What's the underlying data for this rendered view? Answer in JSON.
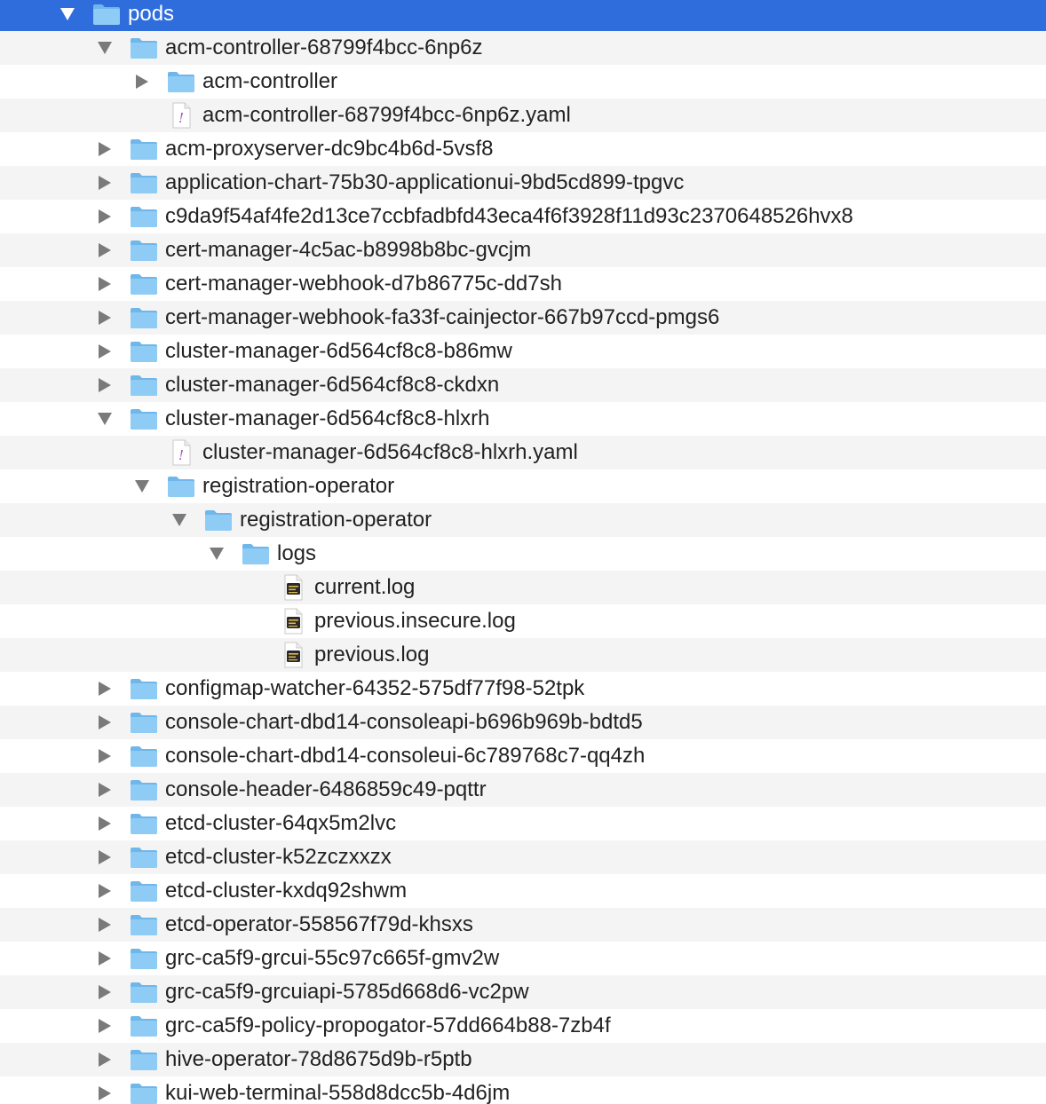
{
  "colors": {
    "selection": "#2f6ddc",
    "folder_icon": "#8ecbf5",
    "stripe": "#f4f4f5"
  },
  "tree": {
    "rows": [
      {
        "depth": 0,
        "type": "folder",
        "expanded": true,
        "selected": true,
        "label": "pods"
      },
      {
        "depth": 1,
        "type": "folder",
        "expanded": true,
        "label": "acm-controller-68799f4bcc-6np6z"
      },
      {
        "depth": 2,
        "type": "folder",
        "expanded": false,
        "label": "acm-controller"
      },
      {
        "depth": 2,
        "type": "yaml",
        "label": "acm-controller-68799f4bcc-6np6z.yaml"
      },
      {
        "depth": 1,
        "type": "folder",
        "expanded": false,
        "label": "acm-proxyserver-dc9bc4b6d-5vsf8"
      },
      {
        "depth": 1,
        "type": "folder",
        "expanded": false,
        "label": "application-chart-75b30-applicationui-9bd5cd899-tpgvc"
      },
      {
        "depth": 1,
        "type": "folder",
        "expanded": false,
        "label": "c9da9f54af4fe2d13ce7ccbfadbfd43eca4f6f3928f11d93c2370648526hvx8"
      },
      {
        "depth": 1,
        "type": "folder",
        "expanded": false,
        "label": "cert-manager-4c5ac-b8998b8bc-gvcjm"
      },
      {
        "depth": 1,
        "type": "folder",
        "expanded": false,
        "label": "cert-manager-webhook-d7b86775c-dd7sh"
      },
      {
        "depth": 1,
        "type": "folder",
        "expanded": false,
        "label": "cert-manager-webhook-fa33f-cainjector-667b97ccd-pmgs6"
      },
      {
        "depth": 1,
        "type": "folder",
        "expanded": false,
        "label": "cluster-manager-6d564cf8c8-b86mw"
      },
      {
        "depth": 1,
        "type": "folder",
        "expanded": false,
        "label": "cluster-manager-6d564cf8c8-ckdxn"
      },
      {
        "depth": 1,
        "type": "folder",
        "expanded": true,
        "label": "cluster-manager-6d564cf8c8-hlxrh"
      },
      {
        "depth": 2,
        "type": "yaml",
        "label": "cluster-manager-6d564cf8c8-hlxrh.yaml"
      },
      {
        "depth": 2,
        "type": "folder",
        "expanded": true,
        "label": "registration-operator"
      },
      {
        "depth": 3,
        "type": "folder",
        "expanded": true,
        "label": "registration-operator"
      },
      {
        "depth": 4,
        "type": "folder",
        "expanded": true,
        "label": "logs"
      },
      {
        "depth": 5,
        "type": "log",
        "label": "current.log"
      },
      {
        "depth": 5,
        "type": "log",
        "label": "previous.insecure.log"
      },
      {
        "depth": 5,
        "type": "log",
        "label": "previous.log"
      },
      {
        "depth": 1,
        "type": "folder",
        "expanded": false,
        "label": "configmap-watcher-64352-575df77f98-52tpk"
      },
      {
        "depth": 1,
        "type": "folder",
        "expanded": false,
        "label": "console-chart-dbd14-consoleapi-b696b969b-bdtd5"
      },
      {
        "depth": 1,
        "type": "folder",
        "expanded": false,
        "label": "console-chart-dbd14-consoleui-6c789768c7-qq4zh"
      },
      {
        "depth": 1,
        "type": "folder",
        "expanded": false,
        "label": "console-header-6486859c49-pqttr"
      },
      {
        "depth": 1,
        "type": "folder",
        "expanded": false,
        "label": "etcd-cluster-64qx5m2lvc"
      },
      {
        "depth": 1,
        "type": "folder",
        "expanded": false,
        "label": "etcd-cluster-k52zczxxzx"
      },
      {
        "depth": 1,
        "type": "folder",
        "expanded": false,
        "label": "etcd-cluster-kxdq92shwm"
      },
      {
        "depth": 1,
        "type": "folder",
        "expanded": false,
        "label": "etcd-operator-558567f79d-khsxs"
      },
      {
        "depth": 1,
        "type": "folder",
        "expanded": false,
        "label": "grc-ca5f9-grcui-55c97c665f-gmv2w"
      },
      {
        "depth": 1,
        "type": "folder",
        "expanded": false,
        "label": "grc-ca5f9-grcuiapi-5785d668d6-vc2pw"
      },
      {
        "depth": 1,
        "type": "folder",
        "expanded": false,
        "label": "grc-ca5f9-policy-propogator-57dd664b88-7zb4f"
      },
      {
        "depth": 1,
        "type": "folder",
        "expanded": false,
        "label": "hive-operator-78d8675d9b-r5ptb"
      },
      {
        "depth": 1,
        "type": "folder",
        "expanded": false,
        "label": "kui-web-terminal-558d8dcc5b-4d6jm"
      }
    ]
  }
}
